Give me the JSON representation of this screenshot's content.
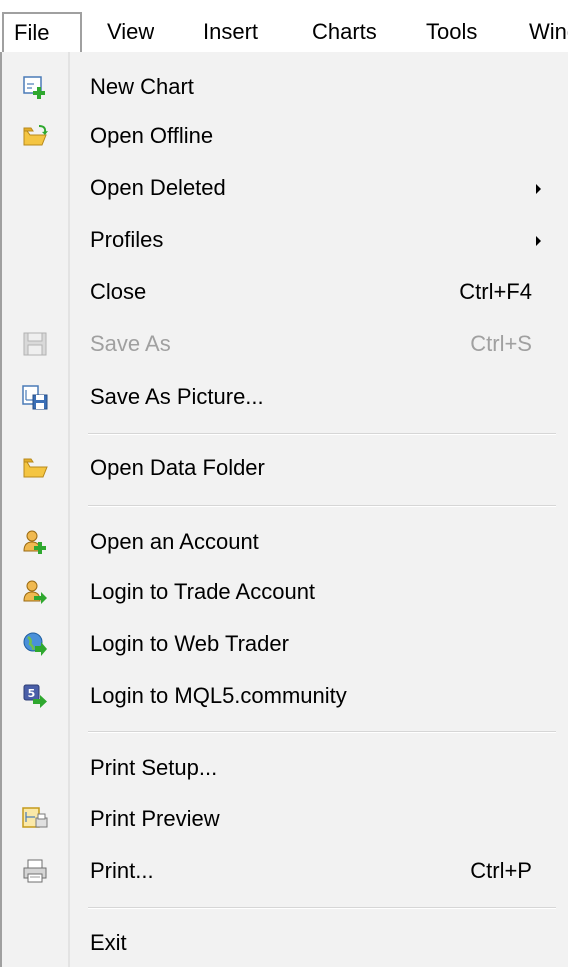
{
  "menubar": {
    "items": [
      "File",
      "View",
      "Insert",
      "Charts",
      "Tools",
      "Window"
    ]
  },
  "file_menu": {
    "new_chart": {
      "label": "New Chart",
      "icon": "new-chart-icon"
    },
    "open_offline": {
      "label": "Open Offline",
      "icon": "open-folder-icon"
    },
    "open_deleted": {
      "label": "Open Deleted",
      "has_submenu": true
    },
    "profiles": {
      "label": "Profiles",
      "has_submenu": true
    },
    "close": {
      "label": "Close",
      "shortcut": "Ctrl+F4"
    },
    "save_as": {
      "label": "Save As",
      "shortcut": "Ctrl+S",
      "disabled": true,
      "icon": "floppy-disk-icon"
    },
    "save_as_picture": {
      "label": "Save As Picture...",
      "icon": "save-picture-icon"
    },
    "open_data_folder": {
      "label": "Open Data Folder",
      "icon": "folder-icon"
    },
    "open_account": {
      "label": "Open an Account",
      "icon": "user-add-icon"
    },
    "login_trade": {
      "label": "Login to Trade Account",
      "icon": "user-login-icon"
    },
    "login_web": {
      "label": "Login to Web Trader",
      "icon": "globe-arrow-icon"
    },
    "login_mql5": {
      "label": "Login to MQL5.community",
      "icon": "mql5-login-icon"
    },
    "print_setup": {
      "label": "Print Setup..."
    },
    "print_preview": {
      "label": "Print Preview",
      "icon": "print-preview-icon"
    },
    "print": {
      "label": "Print...",
      "shortcut": "Ctrl+P",
      "icon": "printer-icon"
    },
    "exit": {
      "label": "Exit"
    }
  },
  "colors": {
    "menu_background": "#f2f2f2",
    "disabled_text": "#a0a0a0",
    "separator": "#d6d6d6",
    "folder_yellow": "#f4c542",
    "arrow_green": "#3fae3f"
  }
}
